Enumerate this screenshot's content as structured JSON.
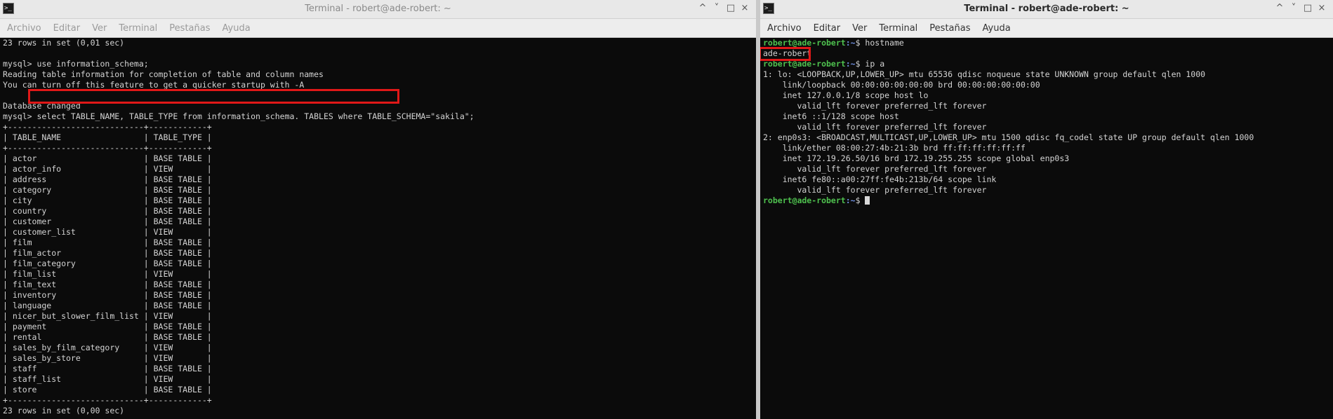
{
  "left_window": {
    "title": "Terminal - robert@ade-robert: ~",
    "menu": [
      "Archivo",
      "Editar",
      "Ver",
      "Terminal",
      "Pestañas",
      "Ayuda"
    ],
    "lines": [
      "23 rows in set (0,01 sec)",
      "",
      "mysql> use information_schema;",
      "Reading table information for completion of table and column names",
      "You can turn off this feature to get a quicker startup with -A",
      "",
      "Database changed",
      "mysql> select TABLE_NAME, TABLE_TYPE from information_schema. TABLES where TABLE_SCHEMA=\"sakila\";",
      "+----------------------------+------------+",
      "| TABLE_NAME                 | TABLE_TYPE |",
      "+----------------------------+------------+",
      "| actor                      | BASE TABLE |",
      "| actor_info                 | VIEW       |",
      "| address                    | BASE TABLE |",
      "| category                   | BASE TABLE |",
      "| city                       | BASE TABLE |",
      "| country                    | BASE TABLE |",
      "| customer                   | BASE TABLE |",
      "| customer_list              | VIEW       |",
      "| film                       | BASE TABLE |",
      "| film_actor                 | BASE TABLE |",
      "| film_category              | BASE TABLE |",
      "| film_list                  | VIEW       |",
      "| film_text                  | BASE TABLE |",
      "| inventory                  | BASE TABLE |",
      "| language                   | BASE TABLE |",
      "| nicer_but_slower_film_list | VIEW       |",
      "| payment                    | BASE TABLE |",
      "| rental                     | BASE TABLE |",
      "| sales_by_film_category     | VIEW       |",
      "| sales_by_store             | VIEW       |",
      "| staff                      | BASE TABLE |",
      "| staff_list                 | VIEW       |",
      "| store                      | BASE TABLE |",
      "+----------------------------+------------+",
      "23 rows in set (0,00 sec)"
    ]
  },
  "right_window": {
    "title": "Terminal - robert@ade-robert: ~",
    "menu": [
      "Archivo",
      "Editar",
      "Ver",
      "Terminal",
      "Pestañas",
      "Ayuda"
    ],
    "prompt_user": "robert@ade-robert",
    "prompt_path": ":~",
    "prompt_symbol": "$",
    "cmd_hostname": " hostname",
    "hostname_output": "ade-robert",
    "cmd_ip": " ip a",
    "ip_lines": [
      "1: lo: <LOOPBACK,UP,LOWER_UP> mtu 65536 qdisc noqueue state UNKNOWN group default qlen 1000",
      "    link/loopback 00:00:00:00:00:00 brd 00:00:00:00:00:00",
      "    inet 127.0.0.1/8 scope host lo",
      "       valid_lft forever preferred_lft forever",
      "    inet6 ::1/128 scope host",
      "       valid_lft forever preferred_lft forever",
      "2: enp0s3: <BROADCAST,MULTICAST,UP,LOWER_UP> mtu 1500 qdisc fq_codel state UP group default qlen 1000",
      "    link/ether 08:00:27:4b:21:3b brd ff:ff:ff:ff:ff:ff",
      "    inet 172.19.26.50/16 brd 172.19.255.255 scope global enp0s3",
      "       valid_lft forever preferred_lft forever",
      "    inet6 fe80::a00:27ff:fe4b:213b/64 scope link",
      "       valid_lft forever preferred_lft forever"
    ]
  },
  "window_buttons": [
    "^",
    "˅",
    "□",
    "×"
  ],
  "colors": {
    "highlight": "#e01818",
    "prompt_user": "#4ec04e",
    "prompt_path": "#6f8fe0"
  }
}
